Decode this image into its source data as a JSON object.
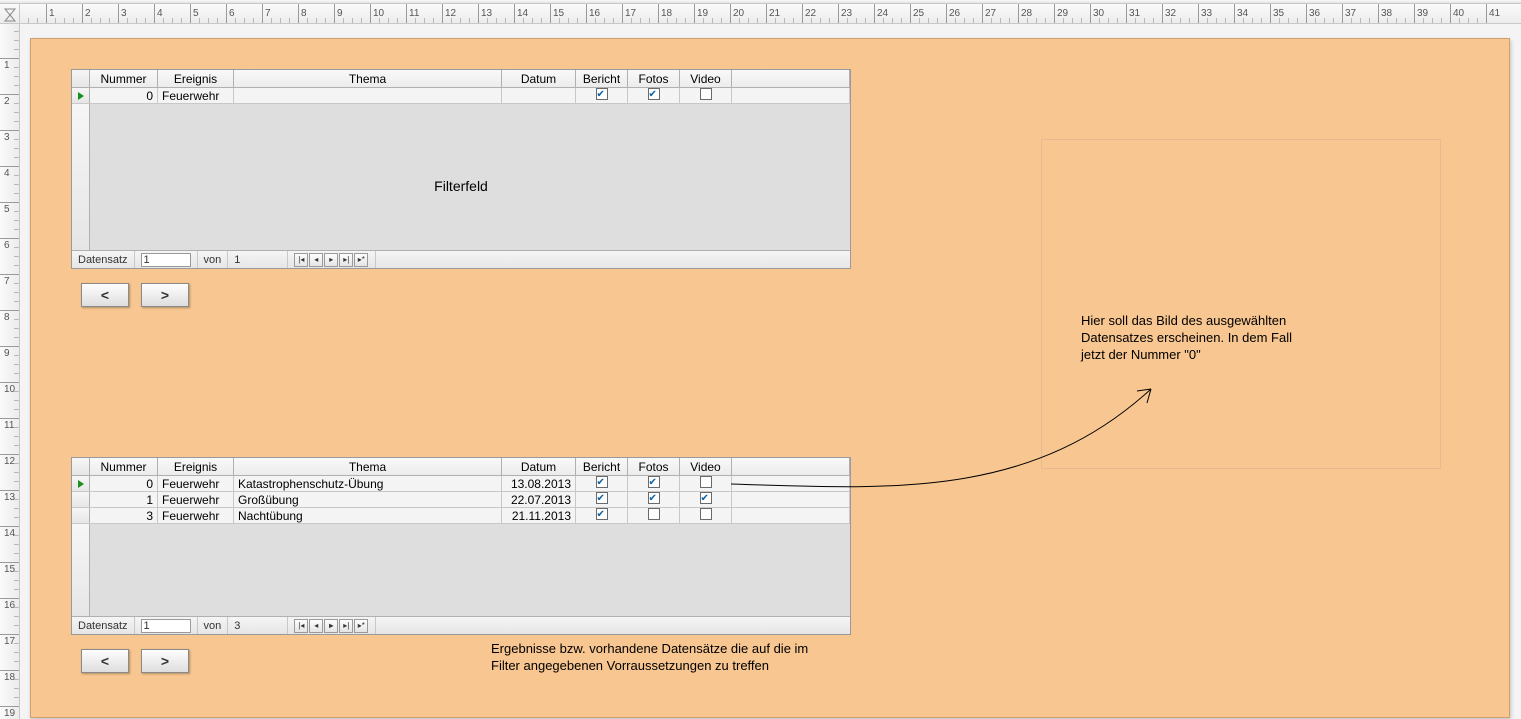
{
  "ruler": {
    "units_h": 41,
    "units_v": 19,
    "spacing": 36
  },
  "columns": {
    "nummer": "Nummer",
    "ereignis": "Ereignis",
    "thema": "Thema",
    "datum": "Datum",
    "bericht": "Bericht",
    "fotos": "Fotos",
    "video": "Video"
  },
  "filter_form": {
    "row": {
      "nummer": "0",
      "ereignis": "Feuerwehr",
      "thema": "",
      "datum": "",
      "bericht": true,
      "fotos": true,
      "video": false
    },
    "placeholder_label": "Filterfeld",
    "recordbar": {
      "label": "Datensatz",
      "current": "1",
      "of_label": "von",
      "total": "1"
    }
  },
  "results_form": {
    "rows": [
      {
        "nummer": "0",
        "ereignis": "Feuerwehr",
        "thema": "Katastrophenschutz-Übung",
        "datum": "13.08.2013",
        "bericht": true,
        "fotos": true,
        "video": false
      },
      {
        "nummer": "1",
        "ereignis": "Feuerwehr",
        "thema": "Großübung",
        "datum": "22.07.2013",
        "bericht": true,
        "fotos": true,
        "video": true
      },
      {
        "nummer": "3",
        "ereignis": "Feuerwehr",
        "thema": "Nachtübung",
        "datum": "21.11.2013",
        "bericht": true,
        "fotos": false,
        "video": false
      }
    ],
    "recordbar": {
      "label": "Datensatz",
      "current": "1",
      "of_label": "von",
      "total": "3"
    }
  },
  "nav_symbols": {
    "prev": "<",
    "next": ">"
  },
  "notes": {
    "image_note": "Hier soll das Bild des ausgewählten Datensatzes erscheinen. In dem Fall jetzt der Nummer \"0\"",
    "results_note": "Ergebnisse bzw. vorhandene Datensätze die auf die im Filter angegebenen Vorraussetzungen zu treffen"
  }
}
